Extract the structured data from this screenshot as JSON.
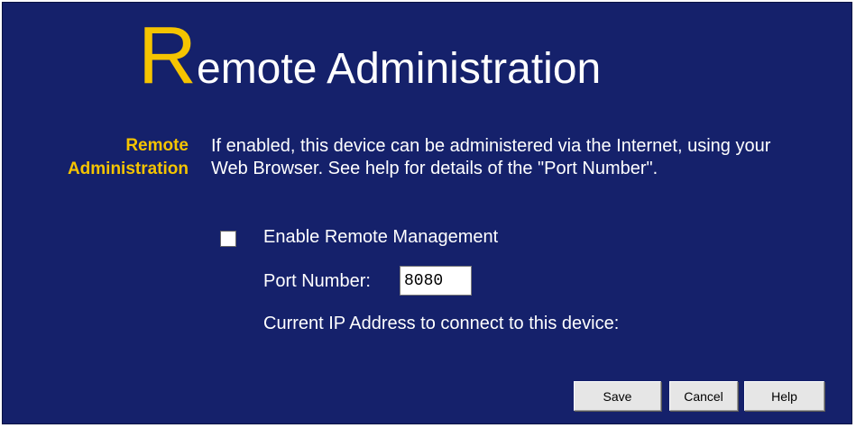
{
  "header": {
    "title_initial": "R",
    "title_rest": "emote Administration"
  },
  "section": {
    "label_line1": "Remote",
    "label_line2": "Administration",
    "description": "If enabled, this device can be administered via the Internet, using your Web Browser. See help for details of the \"Port Number\"."
  },
  "form": {
    "enable_label": "Enable Remote Management",
    "enable_checked": false,
    "port_label": "Port Number:",
    "port_value": "8080",
    "ip_label": "Current IP Address to connect to this device:"
  },
  "buttons": {
    "save": "Save",
    "cancel": "Cancel",
    "help": "Help"
  },
  "colors": {
    "background": "#15216b",
    "accent": "#f5c400",
    "text": "#ffffff"
  }
}
